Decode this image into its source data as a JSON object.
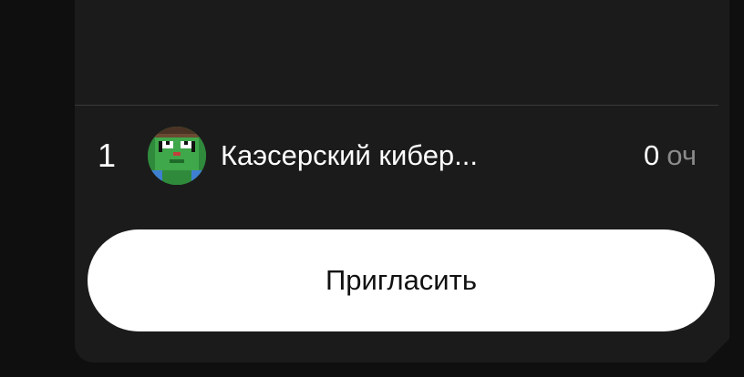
{
  "leaderboard": {
    "rows": [
      {
        "rank": "1",
        "name": "Каэсерский кибер...",
        "score": "0",
        "score_unit": "оч",
        "avatar_icon": "pixel-zombie-avatar-icon"
      }
    ]
  },
  "actions": {
    "invite_label": "Пригласить"
  },
  "colors": {
    "background": "#0f0f0f",
    "panel": "#1b1b1b",
    "avatar_green": "#2f8a3c",
    "button": "#ffffff",
    "muted_text": "#8b8b8b"
  }
}
